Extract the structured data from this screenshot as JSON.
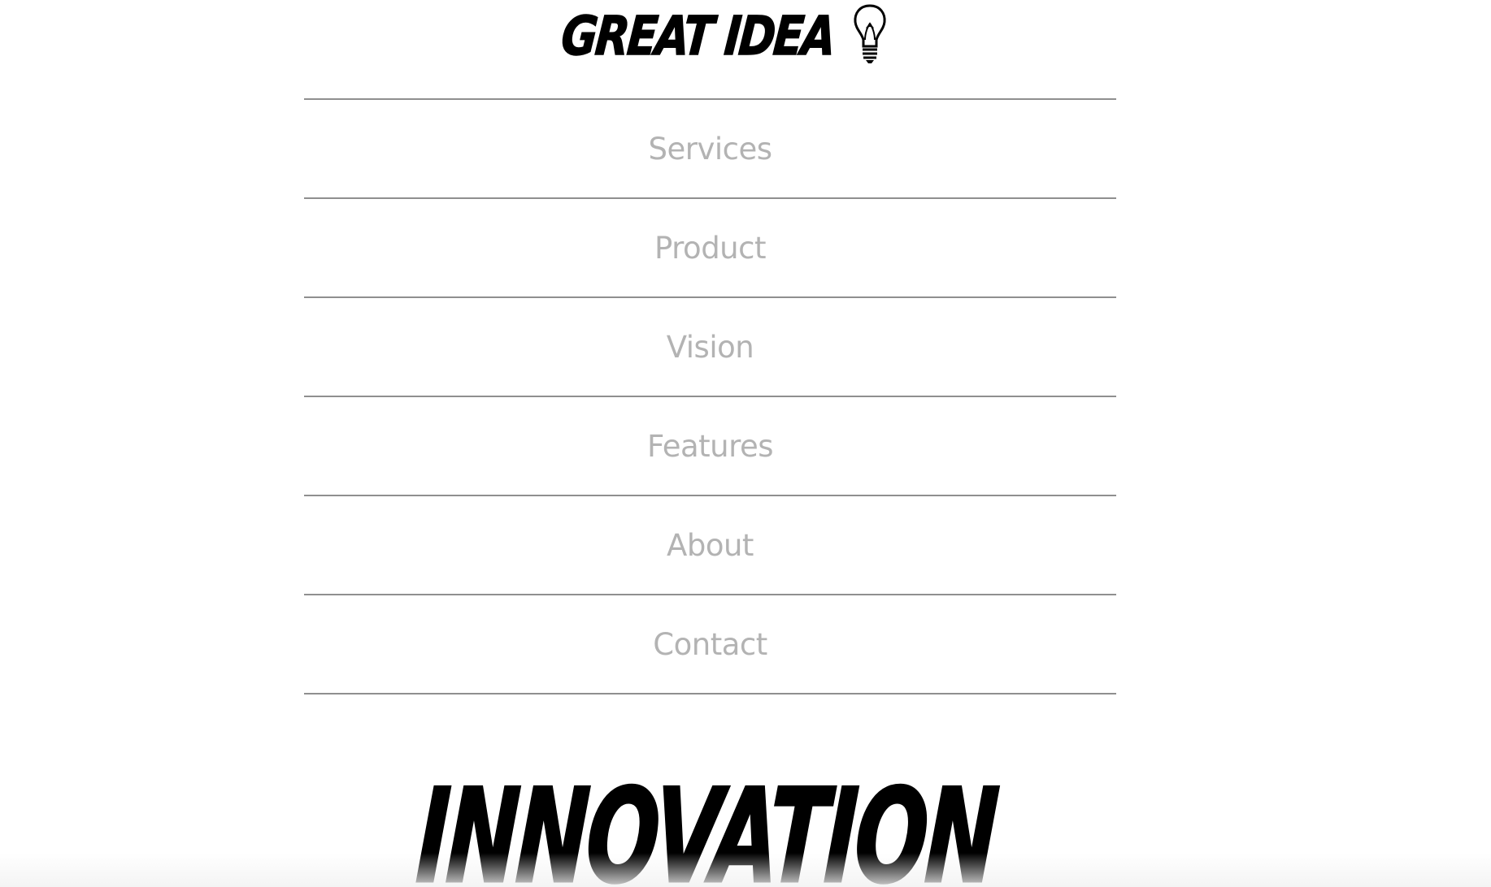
{
  "logo": {
    "text": "GREAT IDEA",
    "icon": "lightbulb-icon"
  },
  "nav": {
    "items": [
      {
        "label": "Services"
      },
      {
        "label": "Product"
      },
      {
        "label": "Vision"
      },
      {
        "label": "Features"
      },
      {
        "label": "About"
      },
      {
        "label": "Contact"
      }
    ]
  },
  "hero": {
    "title": "INNOVATION"
  },
  "colors": {
    "nav_text": "#b3b3b3",
    "divider": "#8f8f8f",
    "logo": "#000000",
    "background": "#ffffff"
  }
}
